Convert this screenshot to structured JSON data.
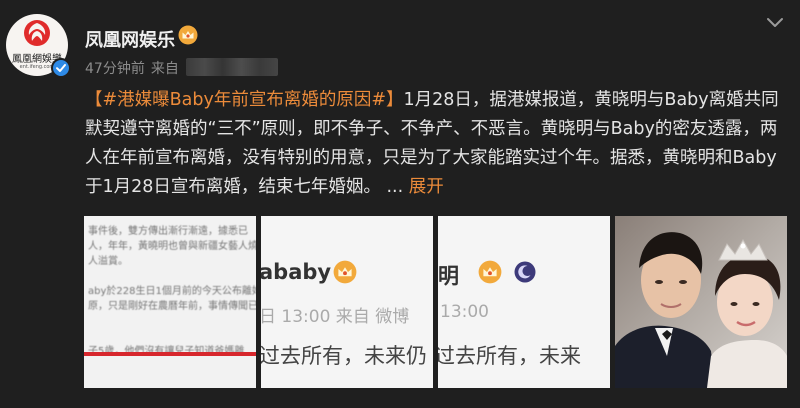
{
  "post": {
    "author_name": "凤凰网娱乐",
    "time_ago": "47分钟前",
    "from_label": "来自",
    "body_hashtag": "【#港媒曝Baby年前宣布离婚的原因#】",
    "body_text": "1月28日，据港媒报道，黄晓明与Baby离婚共同默契遵守离婚的“三不”原则，即不争子、不争产、不恶言。黄晓明与Baby的密友透露，两人在年前宣布离婚，没有特别的用意，只是为了大家能踏实过个年。据悉，黄晓明和Baby于1月28日宣布离婚，结束七年婚姻。",
    "ellipsis": " ... ",
    "expand_label": "展开"
  },
  "avatar": {
    "logo_text": "鳳凰網娛樂",
    "logo_url": "ent.ifeng.com"
  },
  "thumbnails": {
    "t1_lines": [
      "事件後，雙方傳出漸行漸遠，據悉已",
      "人，年年，黃曉明也曾與新疆女藝人燒",
      "人溢賞。",
      "",
      "aby於228生日1個月前的今天公布離婚",
      "原，只是剛好在農曆年前，事情傳聞已",
      "",
      "",
      "子5歲，他們沒有讓兒子知道爸媽離"
    ],
    "t2_name": "ababy",
    "t2_time": "日 13:00  来自 微博",
    "t2_quote": "过去所有，未来仍",
    "t3_name": "明",
    "t3_time": "13:00",
    "t3_quote": "过去所有，未来"
  },
  "colors": {
    "background": "#1f1f1f",
    "accent": "#ec8b3a",
    "verify_blue": "#2e8ae6",
    "crown_gold": "#f2a93b"
  },
  "icons": {
    "verified": "verified-badge-icon",
    "crown": "crown-icon",
    "menu": "chevron-down-icon"
  }
}
